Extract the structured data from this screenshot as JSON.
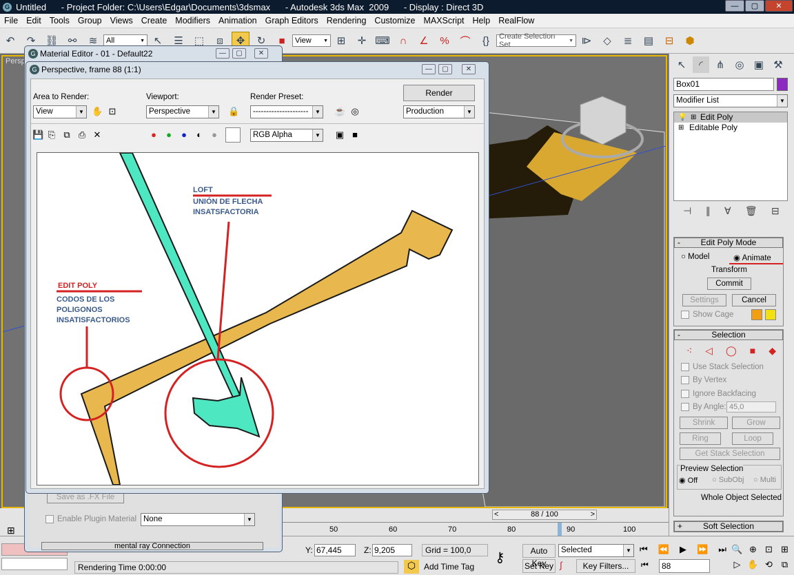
{
  "titlebar": {
    "title": "Untitled      - Project Folder: C:\\Users\\Edgar\\Documents\\3dsmax      - Autodesk 3ds Max  2009      - Display : Direct 3D",
    "min": "—",
    "max": "▢",
    "close": "✕"
  },
  "menu": [
    "File",
    "Edit",
    "Tools",
    "Group",
    "Views",
    "Create",
    "Modifiers",
    "Animation",
    "Graph Editors",
    "Rendering",
    "Customize",
    "MAXScript",
    "Help",
    "RealFlow"
  ],
  "toolbar": {
    "filter_value": "All",
    "refcoord_value": "View",
    "selection_set_placeholder": "Create Selection Set"
  },
  "viewport": {
    "label": "Persp"
  },
  "material_editor": {
    "title": "Material Editor - 01 - Default22",
    "enable_plugin_label": "Enable Plugin Material",
    "plugin_value": "None",
    "save_fx_label": "Save as .FX File",
    "mental_ray_label": "mental ray Connection"
  },
  "render_window": {
    "title": "Perspective, frame 88 (1:1)",
    "area_label": "Area to Render:",
    "area_value": "View",
    "viewport_label": "Viewport:",
    "viewport_value": "Perspective",
    "preset_label": "Render Preset:",
    "preset_value": "---------------------",
    "render_button": "Render",
    "production_value": "Production",
    "channel_value": "RGB Alpha"
  },
  "annotations": {
    "loft_title": "LOFT",
    "loft_line1": "UNIÓN DE FLECHA",
    "loft_line2": "INSATSFACTORIA",
    "edit_title": "EDIT POLY",
    "edit_line1": "CODOS DE LOS",
    "edit_line2": "POLIGONOS",
    "edit_line3": "INSATISFACTORIOS"
  },
  "colors": {
    "annot_red": "#d42222",
    "annot_blue": "#3a5a8a",
    "arrow_gold": "#e8b84e",
    "arrow_teal": "#4de8c2",
    "accent_yellow": "#e8b800"
  },
  "command_panel": {
    "object_name": "Box01",
    "object_color": "#8b2bbf",
    "modifier_list": "Modifier List",
    "stack": [
      "Edit Poly",
      "Editable Poly"
    ],
    "edit_poly_mode": {
      "title": "Edit Poly Mode",
      "model": "Model",
      "animate": "Animate",
      "transform": "Transform",
      "commit": "Commit",
      "settings": "Settings",
      "cancel": "Cancel",
      "show_cage": "Show Cage"
    },
    "selection": {
      "title": "Selection",
      "use_stack": "Use Stack Selection",
      "by_vertex": "By Vertex",
      "ignore_backfacing": "Ignore Backfacing",
      "by_angle": "By Angle:",
      "angle_value": "45,0",
      "shrink": "Shrink",
      "grow": "Grow",
      "ring": "Ring",
      "loop": "Loop",
      "get_stack": "Get Stack Selection",
      "preview_title": "Preview Selection",
      "off": "Off",
      "subobj": "SubObj",
      "multi": "Multi",
      "status": "Whole Object Selected"
    },
    "soft_selection": "Soft Selection"
  },
  "timeline": {
    "frame_display": "88 / 100",
    "ticks": [
      "50",
      "60",
      "70",
      "80",
      "90",
      "100"
    ],
    "current_frame": 88
  },
  "status": {
    "y_label": "Y:",
    "y_value": "67,445",
    "z_label": "Z:",
    "z_value": "9,205",
    "grid": "Grid = 100,0",
    "rendering_time": "Rendering Time  0:00:00",
    "add_time_tag": "Add Time Tag",
    "auto_key": "Auto Key",
    "set_key": "Set Key",
    "selected_value": "Selected",
    "key_filters": "Key Filters...",
    "frame_value": "88"
  }
}
